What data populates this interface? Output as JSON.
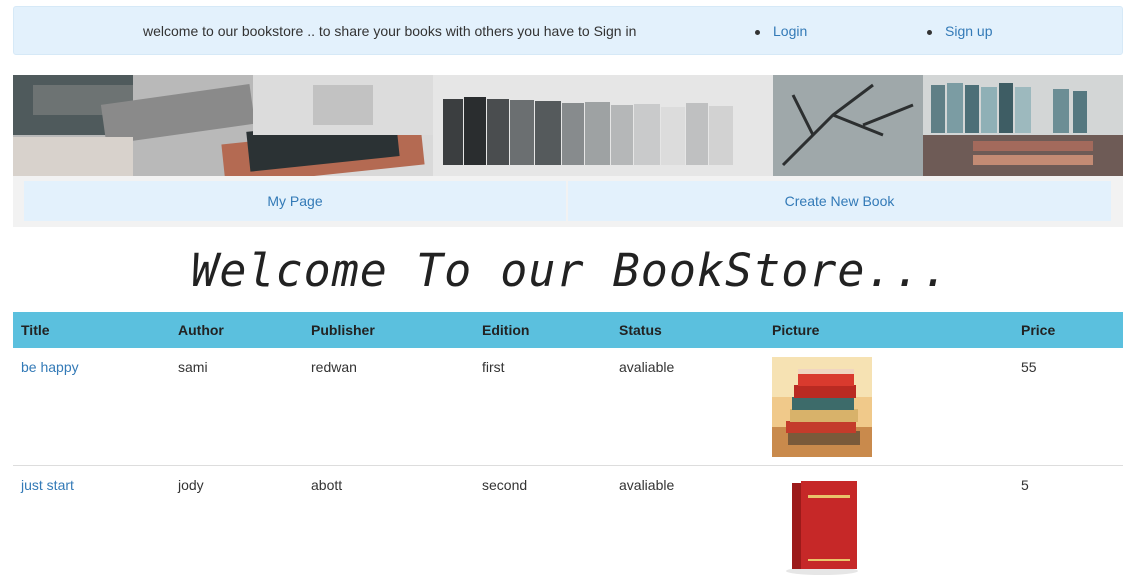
{
  "header": {
    "message": "welcome to our bookstore .. to share your books with others you have to Sign in",
    "login_label": "Login",
    "signup_label": "Sign up"
  },
  "nav": {
    "my_page_label": "My Page",
    "create_book_label": "Create New Book"
  },
  "welcome_heading": "Welcome To our BookStore...",
  "table": {
    "columns": [
      "Title",
      "Author",
      "Publisher",
      "Edition",
      "Status",
      "Picture",
      "Price"
    ],
    "rows": [
      {
        "title": "be happy",
        "author": "sami",
        "publisher": "redwan",
        "edition": "first",
        "status": "avaliable",
        "picture": "book-stack-image",
        "price": "55"
      },
      {
        "title": "just start",
        "author": "jody",
        "publisher": "abott",
        "edition": "second",
        "status": "avaliable",
        "picture": "red-book-image",
        "price": "5"
      }
    ]
  },
  "colors": {
    "header_bg": "#e3f1fc",
    "link": "#337ab7",
    "table_header_bg": "#5bc0de"
  }
}
